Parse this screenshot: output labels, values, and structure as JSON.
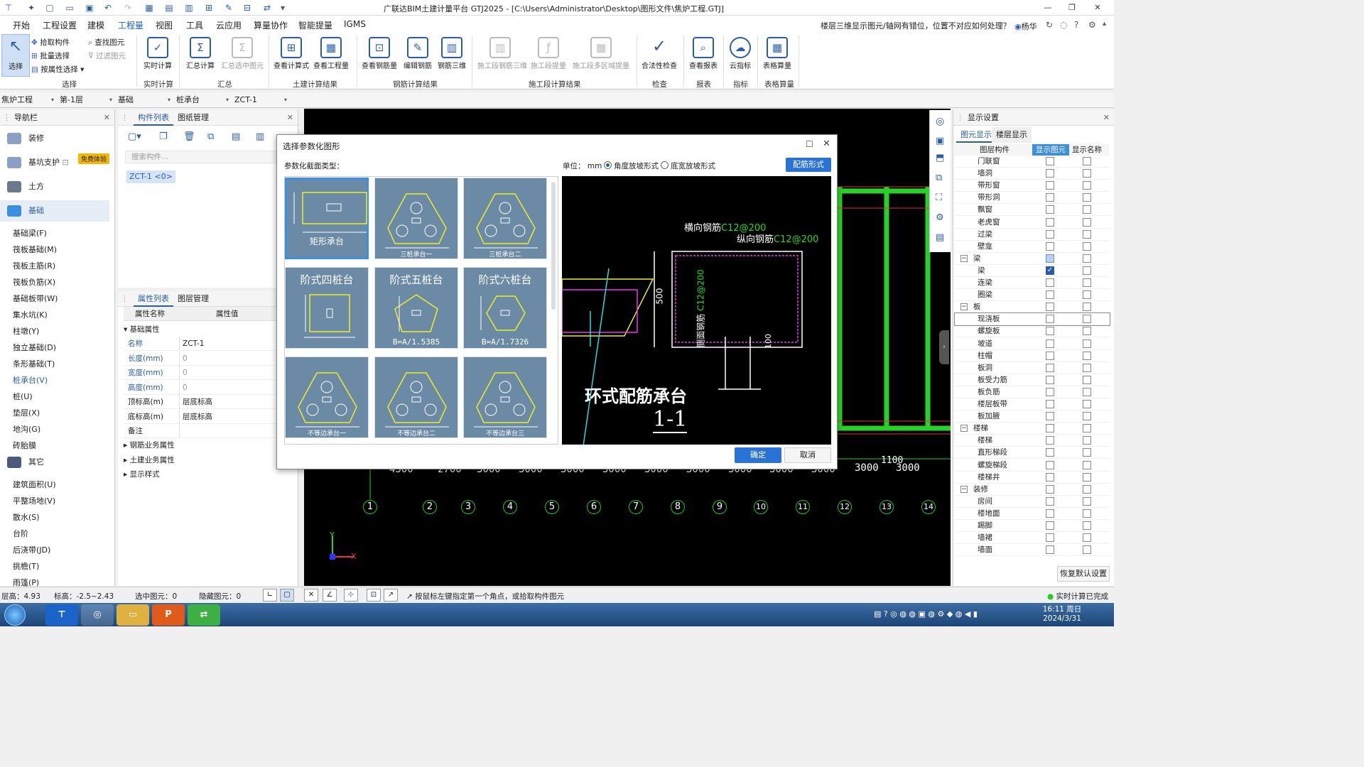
{
  "title": "广联达BIM土建计量平台 GTJ2025 - [C:\\Users\\Administrator\\Desktop\\图形文件\\焦炉工程.GTJ]",
  "menu": [
    "开始",
    "工程设置",
    "建模",
    "工程量",
    "视图",
    "工具",
    "云应用",
    "算量协作",
    "智能提量",
    "IGMS"
  ],
  "help_question": "楼层三维显示图元/轴网有错位，位置不对应如何处理？",
  "user": "杨华",
  "ribbon": {
    "select": {
      "big": "选择",
      "pick": "拾取构件",
      "batch": "批量选择",
      "byattr": "按属性选择",
      "find": "查找图元",
      "filter": "过滤图元",
      "group": "选择"
    },
    "realtime": {
      "label": "实时计算",
      "group": "实时计算"
    },
    "summary": {
      "calc": "汇总计算",
      "selcalc": "汇总选中图元",
      "group": "汇总"
    },
    "civil": {
      "formula": "查看计算式",
      "qty": "查看工程量",
      "group": "土建计算结果"
    },
    "rebar": {
      "view": "查看钢筋量",
      "edit": "编辑钢筋",
      "view3d": "钢筋三维",
      "group": "钢筋计算结果"
    },
    "construct": {
      "r3d": "施工段钢筋三维",
      "qty": "施工段提量",
      "multi": "施工段多区域提量",
      "group": "施工段计算结果"
    },
    "check": {
      "label": "合法性检查",
      "group": "检查"
    },
    "report": {
      "label": "查看报表",
      "group": "报表"
    },
    "index": {
      "label": "云指标",
      "group": "指标"
    },
    "table": {
      "label": "表格算量",
      "group": "表格算量"
    }
  },
  "selectors": [
    "焦炉工程",
    "第-1层",
    "基础",
    "桩承台",
    "ZCT-1"
  ],
  "nav": {
    "title": "导航栏",
    "categories": [
      "装修",
      "基坑支护",
      "土方",
      "基础",
      "其它"
    ],
    "free_badge": "免费体验",
    "foundation_items": [
      "基础梁(F)",
      "筏板基础(M)",
      "筏板主筋(R)",
      "筏板负筋(X)",
      "基础板带(W)",
      "集水坑(K)",
      "柱墩(Y)",
      "独立基础(D)",
      "条形基础(T)",
      "桩承台(V)",
      "桩(U)",
      "垫层(X)",
      "地沟(G)",
      "砖胎膜"
    ],
    "other_items": [
      "建筑面积(U)",
      "平整场地(V)",
      "散水(S)",
      "台阶",
      "后浇带(JD)",
      "挑檐(T)",
      "雨篷(P)"
    ]
  },
  "component_panel": {
    "tabs": [
      "构件列表",
      "图纸管理"
    ],
    "search_placeholder": "搜索构件...",
    "item": "ZCT-1 <0>"
  },
  "property_panel": {
    "tabs": [
      "属性列表",
      "图层管理"
    ],
    "headers": [
      "属性名称",
      "属性值"
    ],
    "section": "基础属性",
    "rows": [
      {
        "name": "名称",
        "value": "ZCT-1"
      },
      {
        "name": "长度(mm)",
        "value": "0"
      },
      {
        "name": "宽度(mm)",
        "value": "0"
      },
      {
        "name": "高度(mm)",
        "value": "0"
      },
      {
        "name": "顶标高(m)",
        "value": "层底标高"
      },
      {
        "name": "底标高(m)",
        "value": "层底标高"
      },
      {
        "name": "备注",
        "value": ""
      }
    ],
    "sections": [
      "钢筋业务属性",
      "土建业务属性",
      "显示样式"
    ]
  },
  "canvas": {
    "axis_numbers": [
      "1",
      "2",
      "3",
      "4",
      "5",
      "6",
      "7",
      "8",
      "9",
      "10",
      "11",
      "12",
      "13",
      "14"
    ],
    "dims": [
      "4300",
      "2700",
      "3000",
      "3000",
      "3000",
      "3000",
      "3000",
      "3000",
      "3000",
      "3000",
      "3000",
      "3000",
      "3000"
    ],
    "dim_extra": "1100",
    "axis_x": "X",
    "axis_y": "Y"
  },
  "display_settings": {
    "title": "显示设置",
    "tabs": [
      "图元显示",
      "楼层显示"
    ],
    "headers": [
      "图层构件",
      "显示图元",
      "显示名称"
    ],
    "rows": [
      {
        "name": "门联窗",
        "group": false,
        "show": false,
        "label": false
      },
      {
        "name": "墙洞",
        "group": false,
        "show": false,
        "label": false
      },
      {
        "name": "带形窗",
        "group": false,
        "show": false,
        "label": false
      },
      {
        "name": "带形洞",
        "group": false,
        "show": false,
        "label": false
      },
      {
        "name": "飘窗",
        "group": false,
        "show": false,
        "label": false
      },
      {
        "name": "老虎窗",
        "group": false,
        "show": false,
        "label": false
      },
      {
        "name": "过梁",
        "group": false,
        "show": false,
        "label": false
      },
      {
        "name": "壁龛",
        "group": false,
        "show": false,
        "label": false
      },
      {
        "name": "梁",
        "group": true,
        "show": "part",
        "label": false
      },
      {
        "name": "梁",
        "group": false,
        "show": true,
        "label": false
      },
      {
        "name": "连梁",
        "group": false,
        "show": false,
        "label": false
      },
      {
        "name": "圈梁",
        "group": false,
        "show": false,
        "label": false
      },
      {
        "name": "板",
        "group": true,
        "show": false,
        "label": false
      },
      {
        "name": "现浇板",
        "group": false,
        "show": false,
        "label": false
      },
      {
        "name": "螺旋板",
        "group": false,
        "show": false,
        "label": false
      },
      {
        "name": "坡道",
        "group": false,
        "show": false,
        "label": false
      },
      {
        "name": "柱帽",
        "group": false,
        "show": false,
        "label": false
      },
      {
        "name": "板洞",
        "group": false,
        "show": false,
        "label": false
      },
      {
        "name": "板受力筋",
        "group": false,
        "show": false,
        "label": false
      },
      {
        "name": "板负筋",
        "group": false,
        "show": false,
        "label": false
      },
      {
        "name": "楼层板带",
        "group": false,
        "show": false,
        "label": false
      },
      {
        "name": "板加腋",
        "group": false,
        "show": false,
        "label": false
      },
      {
        "name": "楼梯",
        "group": true,
        "show": false,
        "label": false
      },
      {
        "name": "楼梯",
        "group": false,
        "show": false,
        "label": false
      },
      {
        "name": "直形梯段",
        "group": false,
        "show": false,
        "label": false
      },
      {
        "name": "螺旋梯段",
        "group": false,
        "show": false,
        "label": false
      },
      {
        "name": "楼梯井",
        "group": false,
        "show": false,
        "label": false
      },
      {
        "name": "装修",
        "group": true,
        "show": false,
        "label": false
      },
      {
        "name": "房间",
        "group": false,
        "show": false,
        "label": false
      },
      {
        "name": "楼地面",
        "group": false,
        "show": false,
        "label": false
      },
      {
        "name": "踢脚",
        "group": false,
        "show": false,
        "label": false
      },
      {
        "name": "墙裙",
        "group": false,
        "show": false,
        "label": false
      },
      {
        "name": "墙面",
        "group": false,
        "show": false,
        "label": false
      }
    ],
    "reset": "恢复默认设置"
  },
  "status": {
    "floor_height": "层高：4.93",
    "elevation": "标高：-2.5~2.43",
    "selected": "选中图元：0",
    "hidden": "隐藏图元：0",
    "hint": "按鼠标左键指定第一个角点，或拾取构件图元",
    "realtime_done": "实时计算已完成"
  },
  "dialog": {
    "title": "选择参数化图形",
    "type_label": "参数化截面类型：",
    "unit_label": "单位：",
    "unit": "mm",
    "radio1": "角度放坡形式",
    "radio2": "底宽放坡形式",
    "config_btn": "配筋形式",
    "thumbs": [
      {
        "title": "矩形承台",
        "sub": ""
      },
      {
        "title": "",
        "sub": "三桩承台一"
      },
      {
        "title": "",
        "sub": "三桩承台二"
      },
      {
        "title": "阶式四桩台",
        "sub": ""
      },
      {
        "title": "阶式五桩台",
        "sub": "B=A/1.5385"
      },
      {
        "title": "阶式六桩台",
        "sub": "B=A/1.7326"
      },
      {
        "title": "",
        "sub": "不等边承台一"
      },
      {
        "title": "",
        "sub": "不等边承台二"
      },
      {
        "title": "",
        "sub": "不等边承台三"
      }
    ],
    "preview": {
      "h_rebar": "横向钢筋",
      "h_rebar_spec": "C12@200",
      "v_rebar": "纵向钢筋",
      "v_rebar_spec": "C12@200",
      "side_rebar": "侧面钢筋",
      "side_rebar_spec": "C12@200",
      "dim_500": "500",
      "dim_100": "100",
      "caption": "环式配筋承台",
      "section": "1-1"
    },
    "ok": "确定",
    "cancel": "取消"
  },
  "clock": {
    "time": "16:11 周日",
    "date": "2024/3/31"
  }
}
